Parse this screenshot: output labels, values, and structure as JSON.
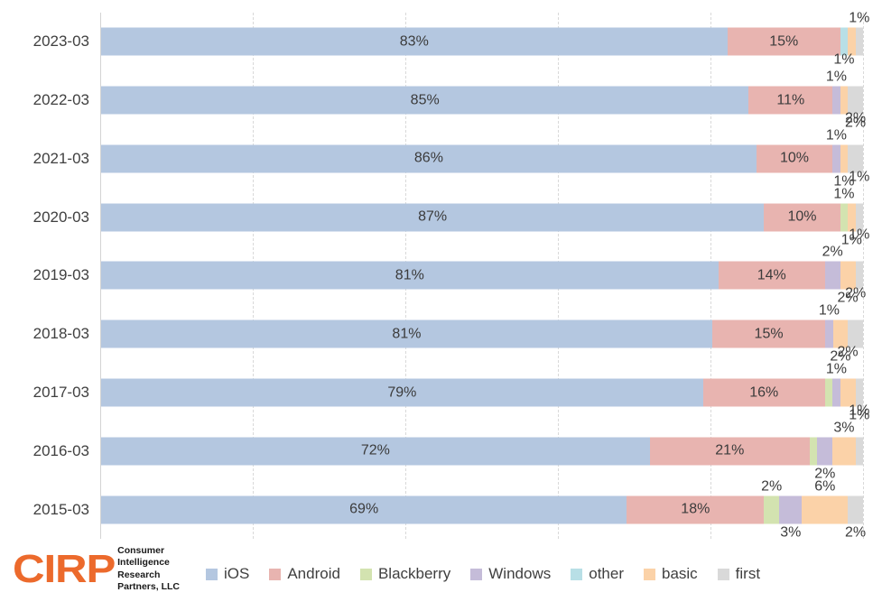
{
  "chart_data": {
    "type": "bar",
    "subtype": "horizontal-stacked-100",
    "title": "",
    "xlabel": "",
    "ylabel": "",
    "xlim": [
      0,
      100
    ],
    "grid": true,
    "gridlines_at": [
      0,
      20,
      40,
      60,
      80,
      100
    ],
    "legend_position": "bottom",
    "categories": [
      "2023-03",
      "2022-03",
      "2021-03",
      "2020-03",
      "2019-03",
      "2018-03",
      "2017-03",
      "2016-03",
      "2015-03"
    ],
    "series": [
      {
        "name": "iOS",
        "color": "#b4c7e0",
        "values": [
          83,
          85,
          86,
          87,
          81,
          81,
          79,
          72,
          69
        ]
      },
      {
        "name": "Android",
        "color": "#e8b4b0",
        "values": [
          15,
          11,
          10,
          10,
          14,
          15,
          16,
          21,
          18
        ]
      },
      {
        "name": "Blackberry",
        "color": "#d3e3b0",
        "values": [
          0,
          0,
          0,
          1,
          0,
          0,
          1,
          1,
          2
        ]
      },
      {
        "name": "Windows",
        "color": "#c5bcd9",
        "values": [
          0,
          1,
          1,
          0,
          2,
          1,
          1,
          2,
          3
        ]
      },
      {
        "name": "other",
        "color": "#b8dfe6",
        "values": [
          1,
          0,
          0,
          0,
          0,
          0,
          0,
          0,
          0
        ]
      },
      {
        "name": "basic",
        "color": "#fbd2a8",
        "values": [
          1,
          1,
          1,
          1,
          2,
          2,
          2,
          3,
          6
        ]
      },
      {
        "name": "first",
        "color": "#d9d9d9",
        "values": [
          1,
          2,
          2,
          1,
          1,
          2,
          1,
          1,
          2
        ]
      }
    ],
    "bars": [
      {
        "category": "2023-03",
        "segments": [
          {
            "series": "iOS",
            "value": 83,
            "label": "83%",
            "label_pos": "inside"
          },
          {
            "series": "Android",
            "value": 15,
            "label": "15%",
            "label_pos": "inside"
          },
          {
            "series": "other",
            "value": 1,
            "label": "",
            "label_pos": "none"
          },
          {
            "series": "basic",
            "value": 1,
            "label": "",
            "label_pos": "none"
          },
          {
            "series": "first",
            "value": 1,
            "label": "1%",
            "label_pos": "above"
          }
        ]
      },
      {
        "category": "2022-03",
        "segments": [
          {
            "series": "iOS",
            "value": 85,
            "label": "85%",
            "label_pos": "inside"
          },
          {
            "series": "Android",
            "value": 11,
            "label": "11%",
            "label_pos": "inside"
          },
          {
            "series": "Windows",
            "value": 1,
            "label": "1%",
            "label_pos": "above"
          },
          {
            "series": "basic",
            "value": 1,
            "label": "1%",
            "label_pos": "above2"
          },
          {
            "series": "first",
            "value": 2,
            "label": "2%",
            "label_pos": "below"
          }
        ]
      },
      {
        "category": "2021-03",
        "segments": [
          {
            "series": "iOS",
            "value": 86,
            "label": "86%",
            "label_pos": "inside"
          },
          {
            "series": "Android",
            "value": 10,
            "label": "10%",
            "label_pos": "inside"
          },
          {
            "series": "Windows",
            "value": 1,
            "label": "1%",
            "label_pos": "above"
          },
          {
            "series": "basic",
            "value": 1,
            "label": "1%",
            "label_pos": "below"
          },
          {
            "series": "first",
            "value": 2,
            "label": "2%",
            "label_pos": "above2"
          }
        ]
      },
      {
        "category": "2020-03",
        "segments": [
          {
            "series": "iOS",
            "value": 87,
            "label": "87%",
            "label_pos": "inside"
          },
          {
            "series": "Android",
            "value": 10,
            "label": "10%",
            "label_pos": "inside"
          },
          {
            "series": "Blackberry",
            "value": 1,
            "label": "1%",
            "label_pos": "above"
          },
          {
            "series": "basic",
            "value": 1,
            "label": "1%",
            "label_pos": "below"
          },
          {
            "series": "first",
            "value": 1,
            "label": "1%",
            "label_pos": "above2"
          }
        ]
      },
      {
        "category": "2019-03",
        "segments": [
          {
            "series": "iOS",
            "value": 81,
            "label": "81%",
            "label_pos": "inside"
          },
          {
            "series": "Android",
            "value": 14,
            "label": "14%",
            "label_pos": "inside"
          },
          {
            "series": "Windows",
            "value": 2,
            "label": "2%",
            "label_pos": "above"
          },
          {
            "series": "basic",
            "value": 2,
            "label": "2%",
            "label_pos": "below"
          },
          {
            "series": "first",
            "value": 1,
            "label": "1%",
            "label_pos": "above2"
          }
        ]
      },
      {
        "category": "2018-03",
        "segments": [
          {
            "series": "iOS",
            "value": 81,
            "label": "81%",
            "label_pos": "inside"
          },
          {
            "series": "Android",
            "value": 15,
            "label": "15%",
            "label_pos": "inside"
          },
          {
            "series": "Windows",
            "value": 1,
            "label": "1%",
            "label_pos": "above"
          },
          {
            "series": "basic",
            "value": 2,
            "label": "2%",
            "label_pos": "below"
          },
          {
            "series": "first",
            "value": 2,
            "label": "2%",
            "label_pos": "above2"
          }
        ]
      },
      {
        "category": "2017-03",
        "segments": [
          {
            "series": "iOS",
            "value": 79,
            "label": "79%",
            "label_pos": "inside"
          },
          {
            "series": "Android",
            "value": 16,
            "label": "16%",
            "label_pos": "inside"
          },
          {
            "series": "Blackberry",
            "value": 1,
            "label": "",
            "label_pos": "none"
          },
          {
            "series": "Windows",
            "value": 1,
            "label": "1%",
            "label_pos": "above"
          },
          {
            "series": "basic",
            "value": 2,
            "label": "2%",
            "label_pos": "above2"
          },
          {
            "series": "first",
            "value": 1,
            "label": "1%",
            "label_pos": "below"
          }
        ]
      },
      {
        "category": "2016-03",
        "segments": [
          {
            "series": "iOS",
            "value": 72,
            "label": "72%",
            "label_pos": "inside"
          },
          {
            "series": "Android",
            "value": 21,
            "label": "21%",
            "label_pos": "inside"
          },
          {
            "series": "Blackberry",
            "value": 1,
            "label": "",
            "label_pos": "none"
          },
          {
            "series": "Windows",
            "value": 2,
            "label": "2%",
            "label_pos": "below"
          },
          {
            "series": "basic",
            "value": 3,
            "label": "3%",
            "label_pos": "above"
          },
          {
            "series": "first",
            "value": 1,
            "label": "1%",
            "label_pos": "above2"
          }
        ]
      },
      {
        "category": "2015-03",
        "segments": [
          {
            "series": "iOS",
            "value": 69,
            "label": "69%",
            "label_pos": "inside"
          },
          {
            "series": "Android",
            "value": 18,
            "label": "18%",
            "label_pos": "inside"
          },
          {
            "series": "Blackberry",
            "value": 2,
            "label": "2%",
            "label_pos": "above"
          },
          {
            "series": "Windows",
            "value": 3,
            "label": "3%",
            "label_pos": "below"
          },
          {
            "series": "basic",
            "value": 6,
            "label": "6%",
            "label_pos": "above"
          },
          {
            "series": "first",
            "value": 2,
            "label": "2%",
            "label_pos": "below"
          }
        ]
      }
    ]
  },
  "legend": {
    "items": [
      {
        "label": "iOS",
        "color": "#b4c7e0"
      },
      {
        "label": "Android",
        "color": "#e8b4b0"
      },
      {
        "label": "Blackberry",
        "color": "#d3e3b0"
      },
      {
        "label": "Windows",
        "color": "#c5bcd9"
      },
      {
        "label": "other",
        "color": "#b8dfe6"
      },
      {
        "label": "basic",
        "color": "#fbd2a8"
      },
      {
        "label": "first",
        "color": "#d9d9d9"
      }
    ]
  },
  "branding": {
    "logo_mark": "CIRP",
    "logo_color": "#ec6a2c",
    "logo_lines": [
      "Consumer",
      "Intelligence",
      "Research",
      "Partners, LLC"
    ]
  }
}
